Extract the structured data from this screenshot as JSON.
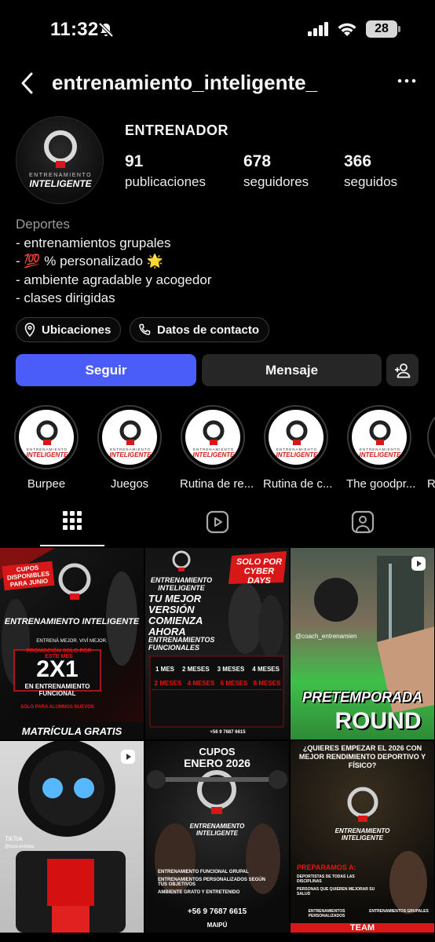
{
  "status_bar": {
    "time": "11:32",
    "battery": "28"
  },
  "header": {
    "username": "entrenamiento_inteligente_"
  },
  "profile": {
    "category": "ENTRENADOR",
    "avatar_logo_text": [
      "ENTRENAMIENTO",
      "INTELIGENTE"
    ],
    "stats": [
      {
        "value": "91",
        "label": "publicaciones"
      },
      {
        "value": "678",
        "label": "seguidores"
      },
      {
        "value": "366",
        "label": "seguidos"
      }
    ],
    "bio": {
      "category": "Deportes",
      "lines": [
        "- entrenamientos grupales",
        "- 💯 % personalizado 🌟",
        "- ambiente agradable y acogedor",
        "- clases dirigidas"
      ]
    },
    "chips": {
      "locations": "Ubicaciones",
      "contact": "Datos de contacto"
    },
    "buttons": {
      "follow": "Seguir",
      "message": "Mensaje"
    }
  },
  "highlights": [
    {
      "label": "Burpee"
    },
    {
      "label": "Juegos"
    },
    {
      "label": "Rutina de re..."
    },
    {
      "label": "Rutina de c..."
    },
    {
      "label": "The goodpr..."
    },
    {
      "label": "R"
    }
  ],
  "tabs": [
    "grid-icon",
    "reels-icon",
    "tagged-icon"
  ],
  "colors": {
    "accent": "#4a5df9",
    "brand_red": "#e01010",
    "background": "#000000"
  },
  "posts": [
    {
      "badge": "CUPOS DISPONIBLES PARA JUNIO",
      "brand": "ENTRENAMIENTO INTELIGENTE",
      "tagline": "ENTRENÁ MEJOR. VIVÍ MEJOR.",
      "promo": "PROMOCIÓN SOLO POR ESTE MES",
      "offer": "2X1",
      "offer_sub": "EN ENTRENAMIENTO FUNCIONAL",
      "new_students": "SOLO PARA ALUMNOS NUEVOS",
      "footer": "MATRÍCULA GRATIS"
    },
    {
      "badge": "SOLO POR CYBER DAYS",
      "brand": "ENTRENAMIENTO INTELIGENTE",
      "headline": "TU MEJOR VERSIÓN COMIENZA AHORA",
      "sub": "ENTRENAMIENTOS FUNCIONALES",
      "plans": [
        "1 MES",
        "2 MESES",
        "3 MESES",
        "4 MESES"
      ],
      "bonus": [
        "2 MESES",
        "4 MESES",
        "6 MESES",
        "8 MESES"
      ],
      "phone": "+56 9 7687 6615"
    },
    {
      "title": "PRETEMPORADA",
      "subtitle": "ROUND",
      "tiktok_user": "@coach_entrenamien"
    },
    {
      "tiktok_label": "TikTok",
      "tiktok_user": "@cesi.entreta"
    },
    {
      "title": "CUPOS",
      "subtitle": "ENERO 2026",
      "brand": "ENTRENAMIENTO INTELIGENTE",
      "list": [
        "ENTRENAMIENTO FUNCIONAL GRUPAL",
        "ENTRENAMIENTOS PERSONALIZADOS SEGÚN TUS OBJETIVOS",
        "AMBIENTE GRATO Y ENTRETENIDO"
      ],
      "phone": "+56 9 7687 6615",
      "place": "MAIPÚ"
    },
    {
      "question": "¿QUIERES EMPEZAR EL 2026 CON MEJOR RENDIMIENTO DEPORTIVO Y FÍSICO?",
      "brand": "ENTRENAMIENTO INTELIGENTE",
      "prep": "PREPARAMOS A:",
      "tags": [
        "DEPORTISTAS DE TODAS LAS DISCIPLINAS",
        "PERSONAS QUE QUIEREN MEJORAR SU SALUD",
        "ENTRENAMIENTOS PERSONALIZADOS",
        "ENTRENAMIENTOS GRUPALES"
      ],
      "footer": "TEAM"
    }
  ]
}
